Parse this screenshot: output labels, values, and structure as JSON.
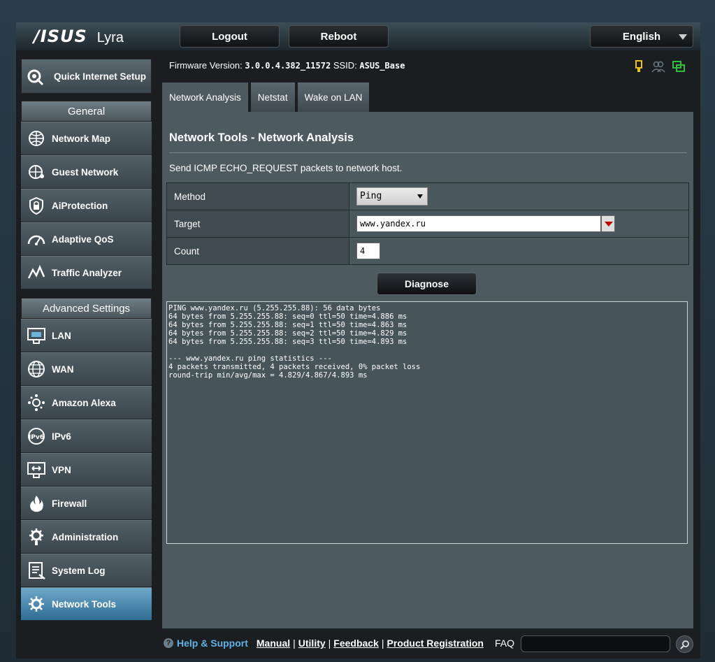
{
  "header": {
    "brand": "/ISUS",
    "model": "Lyra",
    "logout_label": "Logout",
    "reboot_label": "Reboot",
    "language": "English"
  },
  "status": {
    "firmware_label": "Firmware Version:",
    "firmware_value": "3.0.0.4.382_11572",
    "ssid_label": "SSID:",
    "ssid_value": "ASUS_Base"
  },
  "sidebar": {
    "qis_label": "Quick Internet Setup",
    "general_title": "General",
    "general_items": [
      {
        "label": "Network Map",
        "icon": "network-map-icon"
      },
      {
        "label": "Guest Network",
        "icon": "guest-network-icon"
      },
      {
        "label": "AiProtection",
        "icon": "aiprotection-icon"
      },
      {
        "label": "Adaptive QoS",
        "icon": "adaptive-qos-icon"
      },
      {
        "label": "Traffic Analyzer",
        "icon": "traffic-analyzer-icon"
      }
    ],
    "advanced_title": "Advanced Settings",
    "advanced_items": [
      {
        "label": "LAN",
        "icon": "lan-icon"
      },
      {
        "label": "WAN",
        "icon": "wan-icon"
      },
      {
        "label": "Amazon Alexa",
        "icon": "amazon-alexa-icon"
      },
      {
        "label": "IPv6",
        "icon": "ipv6-icon"
      },
      {
        "label": "VPN",
        "icon": "vpn-icon"
      },
      {
        "label": "Firewall",
        "icon": "firewall-icon"
      },
      {
        "label": "Administration",
        "icon": "administration-icon"
      },
      {
        "label": "System Log",
        "icon": "system-log-icon"
      },
      {
        "label": "Network Tools",
        "icon": "network-tools-icon",
        "active": true
      }
    ]
  },
  "tabs": [
    {
      "label": "Network Analysis",
      "active": true
    },
    {
      "label": "Netstat"
    },
    {
      "label": "Wake on LAN"
    }
  ],
  "main": {
    "title": "Network Tools - Network Analysis",
    "description": "Send ICMP ECHO_REQUEST packets to network host.",
    "method_label": "Method",
    "method_value": "Ping",
    "target_label": "Target",
    "target_value": "www.yandex.ru",
    "count_label": "Count",
    "count_value": "4",
    "diagnose_label": "Diagnose",
    "output": "PING www.yandex.ru (5.255.255.88): 56 data bytes\n64 bytes from 5.255.255.88: seq=0 ttl=50 time=4.886 ms\n64 bytes from 5.255.255.88: seq=1 ttl=50 time=4.863 ms\n64 bytes from 5.255.255.88: seq=2 ttl=50 time=4.829 ms\n64 bytes from 5.255.255.88: seq=3 ttl=50 time=4.893 ms\n\n--- www.yandex.ru ping statistics ---\n4 packets transmitted, 4 packets received, 0% packet loss\nround-trip min/avg/max = 4.829/4.867/4.893 ms"
  },
  "footer": {
    "help_label": "Help & Support",
    "links": [
      "Manual",
      "Utility",
      "Feedback",
      "Product Registration"
    ],
    "faq_label": "FAQ"
  },
  "colors": {
    "accent_blue": "#5fb3e6",
    "active_menu": "#2e6d94",
    "status_yellow": "#e8c21a",
    "status_green": "#2fbf3a"
  }
}
